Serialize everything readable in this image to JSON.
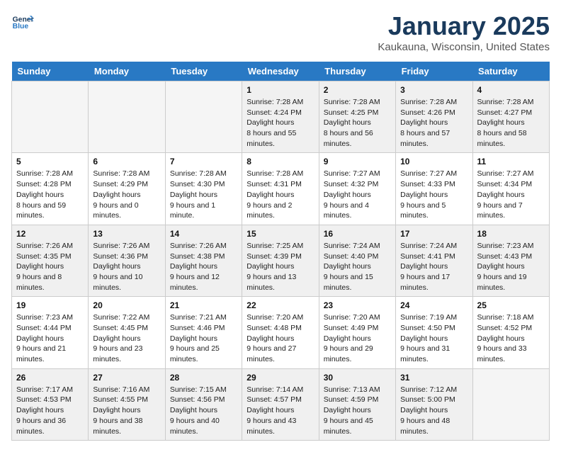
{
  "header": {
    "logo_line1": "General",
    "logo_line2": "Blue",
    "month": "January 2025",
    "location": "Kaukauna, Wisconsin, United States"
  },
  "weekdays": [
    "Sunday",
    "Monday",
    "Tuesday",
    "Wednesday",
    "Thursday",
    "Friday",
    "Saturday"
  ],
  "weeks": [
    [
      {
        "day": "",
        "empty": true
      },
      {
        "day": "",
        "empty": true
      },
      {
        "day": "",
        "empty": true
      },
      {
        "day": "1",
        "sunrise": "7:28 AM",
        "sunset": "4:24 PM",
        "daylight": "8 hours and 55 minutes."
      },
      {
        "day": "2",
        "sunrise": "7:28 AM",
        "sunset": "4:25 PM",
        "daylight": "8 hours and 56 minutes."
      },
      {
        "day": "3",
        "sunrise": "7:28 AM",
        "sunset": "4:26 PM",
        "daylight": "8 hours and 57 minutes."
      },
      {
        "day": "4",
        "sunrise": "7:28 AM",
        "sunset": "4:27 PM",
        "daylight": "8 hours and 58 minutes."
      }
    ],
    [
      {
        "day": "5",
        "sunrise": "7:28 AM",
        "sunset": "4:28 PM",
        "daylight": "8 hours and 59 minutes."
      },
      {
        "day": "6",
        "sunrise": "7:28 AM",
        "sunset": "4:29 PM",
        "daylight": "9 hours and 0 minutes."
      },
      {
        "day": "7",
        "sunrise": "7:28 AM",
        "sunset": "4:30 PM",
        "daylight": "9 hours and 1 minute."
      },
      {
        "day": "8",
        "sunrise": "7:28 AM",
        "sunset": "4:31 PM",
        "daylight": "9 hours and 2 minutes."
      },
      {
        "day": "9",
        "sunrise": "7:27 AM",
        "sunset": "4:32 PM",
        "daylight": "9 hours and 4 minutes."
      },
      {
        "day": "10",
        "sunrise": "7:27 AM",
        "sunset": "4:33 PM",
        "daylight": "9 hours and 5 minutes."
      },
      {
        "day": "11",
        "sunrise": "7:27 AM",
        "sunset": "4:34 PM",
        "daylight": "9 hours and 7 minutes."
      }
    ],
    [
      {
        "day": "12",
        "sunrise": "7:26 AM",
        "sunset": "4:35 PM",
        "daylight": "9 hours and 8 minutes."
      },
      {
        "day": "13",
        "sunrise": "7:26 AM",
        "sunset": "4:36 PM",
        "daylight": "9 hours and 10 minutes."
      },
      {
        "day": "14",
        "sunrise": "7:26 AM",
        "sunset": "4:38 PM",
        "daylight": "9 hours and 12 minutes."
      },
      {
        "day": "15",
        "sunrise": "7:25 AM",
        "sunset": "4:39 PM",
        "daylight": "9 hours and 13 minutes."
      },
      {
        "day": "16",
        "sunrise": "7:24 AM",
        "sunset": "4:40 PM",
        "daylight": "9 hours and 15 minutes."
      },
      {
        "day": "17",
        "sunrise": "7:24 AM",
        "sunset": "4:41 PM",
        "daylight": "9 hours and 17 minutes."
      },
      {
        "day": "18",
        "sunrise": "7:23 AM",
        "sunset": "4:43 PM",
        "daylight": "9 hours and 19 minutes."
      }
    ],
    [
      {
        "day": "19",
        "sunrise": "7:23 AM",
        "sunset": "4:44 PM",
        "daylight": "9 hours and 21 minutes."
      },
      {
        "day": "20",
        "sunrise": "7:22 AM",
        "sunset": "4:45 PM",
        "daylight": "9 hours and 23 minutes."
      },
      {
        "day": "21",
        "sunrise": "7:21 AM",
        "sunset": "4:46 PM",
        "daylight": "9 hours and 25 minutes."
      },
      {
        "day": "22",
        "sunrise": "7:20 AM",
        "sunset": "4:48 PM",
        "daylight": "9 hours and 27 minutes."
      },
      {
        "day": "23",
        "sunrise": "7:20 AM",
        "sunset": "4:49 PM",
        "daylight": "9 hours and 29 minutes."
      },
      {
        "day": "24",
        "sunrise": "7:19 AM",
        "sunset": "4:50 PM",
        "daylight": "9 hours and 31 minutes."
      },
      {
        "day": "25",
        "sunrise": "7:18 AM",
        "sunset": "4:52 PM",
        "daylight": "9 hours and 33 minutes."
      }
    ],
    [
      {
        "day": "26",
        "sunrise": "7:17 AM",
        "sunset": "4:53 PM",
        "daylight": "9 hours and 36 minutes."
      },
      {
        "day": "27",
        "sunrise": "7:16 AM",
        "sunset": "4:55 PM",
        "daylight": "9 hours and 38 minutes."
      },
      {
        "day": "28",
        "sunrise": "7:15 AM",
        "sunset": "4:56 PM",
        "daylight": "9 hours and 40 minutes."
      },
      {
        "day": "29",
        "sunrise": "7:14 AM",
        "sunset": "4:57 PM",
        "daylight": "9 hours and 43 minutes."
      },
      {
        "day": "30",
        "sunrise": "7:13 AM",
        "sunset": "4:59 PM",
        "daylight": "9 hours and 45 minutes."
      },
      {
        "day": "31",
        "sunrise": "7:12 AM",
        "sunset": "5:00 PM",
        "daylight": "9 hours and 48 minutes."
      },
      {
        "day": "",
        "empty": true
      }
    ]
  ]
}
